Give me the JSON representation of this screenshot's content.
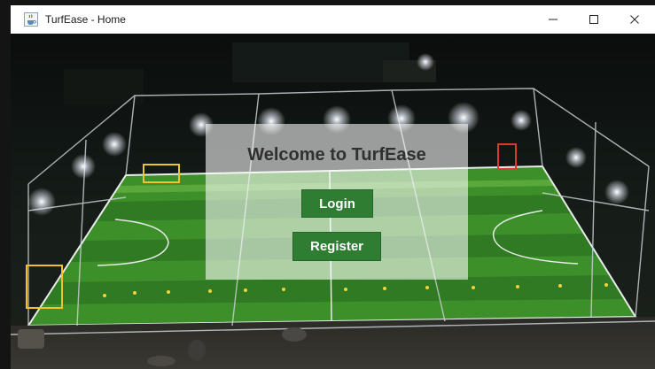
{
  "window": {
    "title": "TurfEase - Home",
    "icon": "java-cup-icon"
  },
  "window_controls": {
    "minimize_icon": "minimize-icon",
    "maximize_icon": "maximize-icon",
    "close_icon": "close-icon"
  },
  "background": {
    "image": "night-football-turf-photo"
  },
  "welcome_panel": {
    "heading": "Welcome to TurfEase",
    "login_label": "Login",
    "register_label": "Register",
    "button_color": "#2e7d32"
  }
}
